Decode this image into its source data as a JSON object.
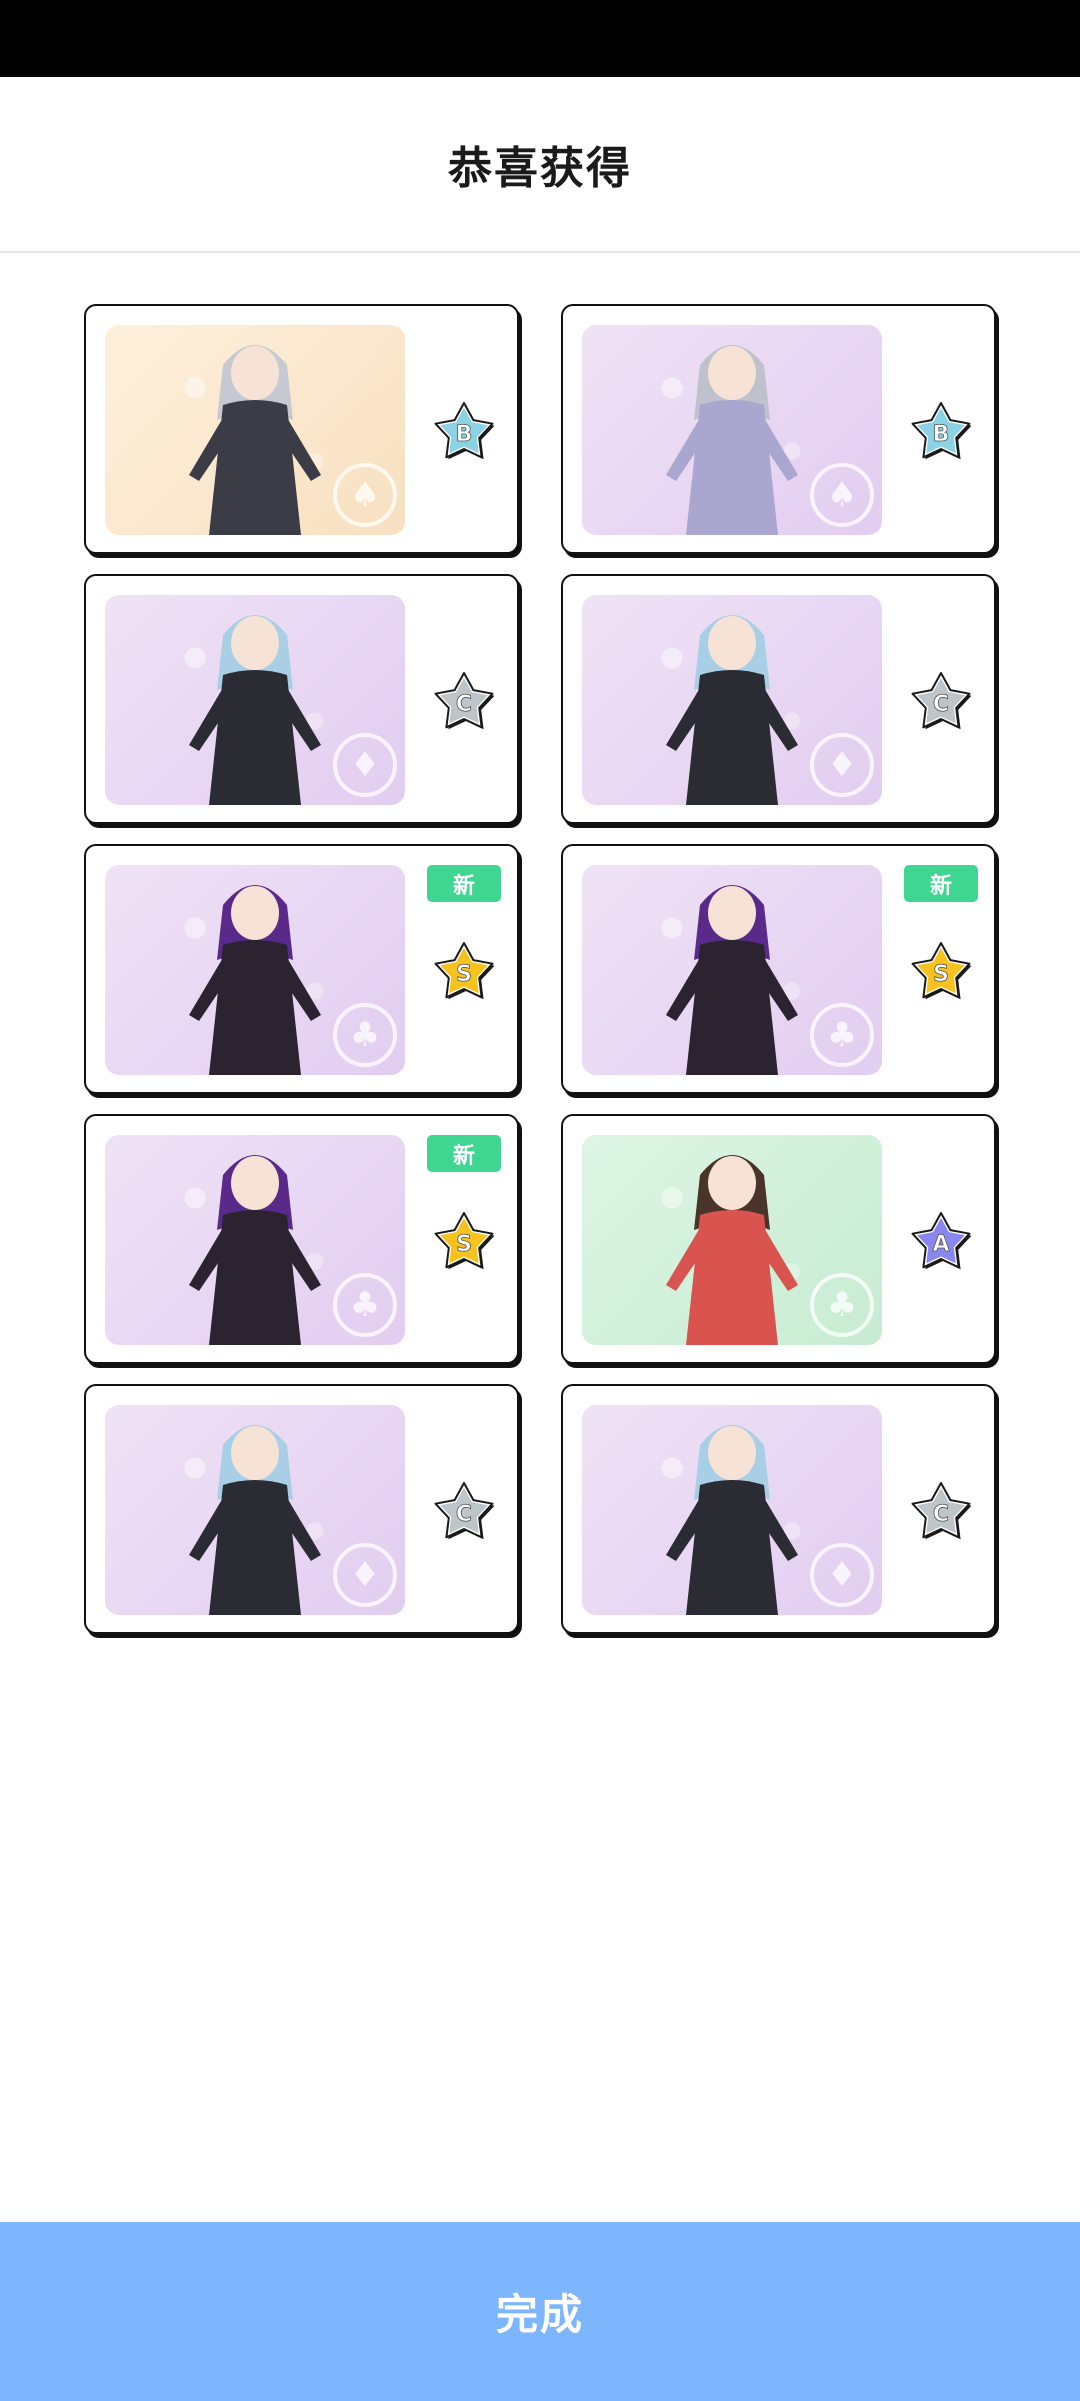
{
  "header": {
    "title": "恭喜获得"
  },
  "colors": {
    "rank_s": "#f6c21e",
    "rank_a": "#8a86f0",
    "rank_b": "#8ad2e4",
    "rank_c": "#bdc5c9",
    "new_badge": "#3fd692",
    "done_button": "#7eb6fd"
  },
  "rewards": [
    {
      "rank": "B",
      "is_new": false,
      "new_label": "",
      "bg": "peach",
      "suit_icon": "spade-icon",
      "hair": "#c6c8d2",
      "outfit": "#3c3c46"
    },
    {
      "rank": "B",
      "is_new": false,
      "new_label": "",
      "bg": "purple",
      "suit_icon": "spade-icon",
      "hair": "#bfc1cc",
      "outfit": "#a9a6cf"
    },
    {
      "rank": "C",
      "is_new": false,
      "new_label": "",
      "bg": "purple",
      "suit_icon": "diamond-icon",
      "hair": "#a9cfe6",
      "outfit": "#2b2b33"
    },
    {
      "rank": "C",
      "is_new": false,
      "new_label": "",
      "bg": "purple",
      "suit_icon": "diamond-icon",
      "hair": "#a9cfe6",
      "outfit": "#2b2b33"
    },
    {
      "rank": "S",
      "is_new": true,
      "new_label": "新",
      "bg": "purple",
      "suit_icon": "club-icon",
      "hair": "#5a2a8a",
      "outfit": "#2b2430"
    },
    {
      "rank": "S",
      "is_new": true,
      "new_label": "新",
      "bg": "purple",
      "suit_icon": "club-icon",
      "hair": "#5a2a8a",
      "outfit": "#2b2430"
    },
    {
      "rank": "S",
      "is_new": true,
      "new_label": "新",
      "bg": "purple",
      "suit_icon": "club-icon",
      "hair": "#5a2a8a",
      "outfit": "#2b2430"
    },
    {
      "rank": "A",
      "is_new": false,
      "new_label": "",
      "bg": "mint",
      "suit_icon": "club-icon",
      "hair": "#4a3328",
      "outfit": "#d9534f"
    },
    {
      "rank": "C",
      "is_new": false,
      "new_label": "",
      "bg": "purple",
      "suit_icon": "diamond-icon",
      "hair": "#a9cfe6",
      "outfit": "#2b2b33"
    },
    {
      "rank": "C",
      "is_new": false,
      "new_label": "",
      "bg": "purple",
      "suit_icon": "diamond-icon",
      "hair": "#a9cfe6",
      "outfit": "#2b2b33"
    }
  ],
  "footer": {
    "done_label": "完成"
  }
}
